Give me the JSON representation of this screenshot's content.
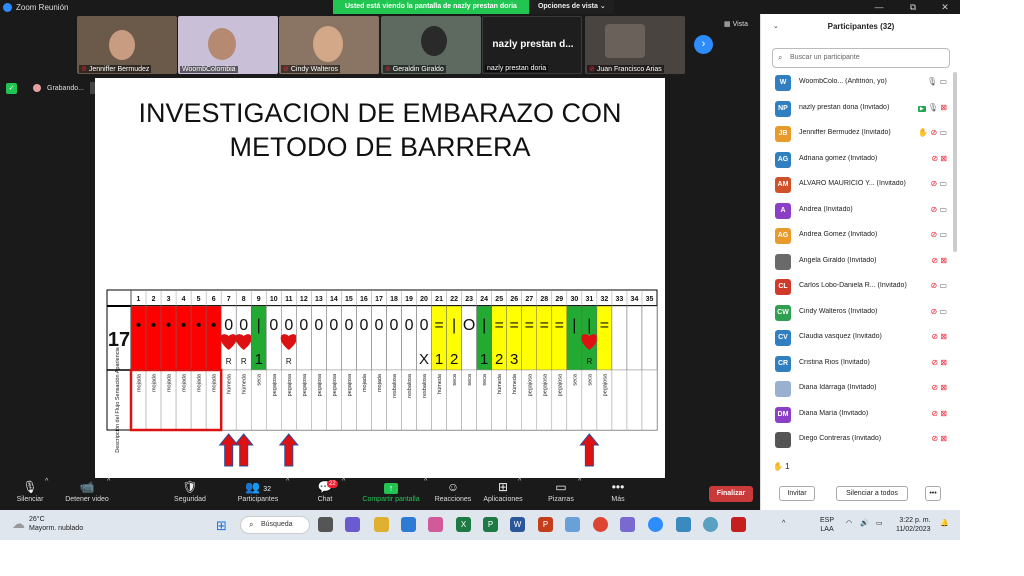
{
  "window": {
    "title": "Zoom Reunión",
    "banner": "Usted está viendo la pantalla de nazly prestan doria",
    "view_options": "Opciones de vista",
    "view_options_caret": "⌄",
    "win_min": "—",
    "win_max": "⧉",
    "win_close": "✕"
  },
  "gallery": {
    "tiles": [
      {
        "name": "Jenniffer Bermudez",
        "bg": "#6b5a4a",
        "muted": true
      },
      {
        "name": "WoombColombia",
        "bg": "#c9c0d8",
        "muted": false
      },
      {
        "name": "Cindy Walteros",
        "bg": "#8a7565",
        "muted": true
      },
      {
        "name": "Geraldin Giraldo",
        "bg": "#5e6a60",
        "muted": true
      },
      {
        "name": "nazly prestan doria",
        "bg": "#1e1e1e",
        "muted": false,
        "big_label": "nazly prestan d..."
      },
      {
        "name": "Juan Francisco Arias",
        "bg": "#4a4440",
        "muted": true
      }
    ],
    "next_icon": "›",
    "view_label": "Vista",
    "view_icon": "▦"
  },
  "recording": {
    "label": "Grabando...",
    "shield_glyph": "✓",
    "pause_glyph": "⏸",
    "stop_glyph": "■"
  },
  "slide": {
    "title_line1": "INVESTIGACION DE EMBARAZO CON",
    "title_line2": "METODO DE BARRERA",
    "row_label": "17",
    "side_label": "Descripción del Flujo Sensación Apariencia",
    "days": [
      "1",
      "2",
      "3",
      "4",
      "5",
      "6",
      "7",
      "8",
      "9",
      "10",
      "11",
      "12",
      "13",
      "14",
      "15",
      "16",
      "17",
      "18",
      "19",
      "20",
      "21",
      "22",
      "23",
      "24",
      "25",
      "26",
      "27",
      "28",
      "29",
      "30",
      "31",
      "32",
      "33",
      "34",
      "35"
    ],
    "cells": [
      {
        "bg": "#ff0000",
        "sym": "•",
        "lbl": "mojada"
      },
      {
        "bg": "#ff0000",
        "sym": "•",
        "lbl": "mojada"
      },
      {
        "bg": "#ff0000",
        "sym": "•",
        "lbl": "mojada"
      },
      {
        "bg": "#ff0000",
        "sym": "•",
        "lbl": "mojada"
      },
      {
        "bg": "#ff0000",
        "sym": "•",
        "lbl": "mojada"
      },
      {
        "bg": "#ff0000",
        "sym": "•",
        "lbl": "mojada"
      },
      {
        "bg": "#ffffff",
        "sym": "0",
        "heart": true,
        "sub": "R",
        "lbl": "húmeda"
      },
      {
        "bg": "#ffffff",
        "sym": "0",
        "heart": true,
        "sub": "R",
        "lbl": "húmeda"
      },
      {
        "bg": "#22aa33",
        "sym": "|",
        "sub": "1",
        "lbl": "seca"
      },
      {
        "bg": "#ffffff",
        "sym": "0",
        "lbl": "pegajosa"
      },
      {
        "bg": "#ffffff",
        "sym": "0",
        "heart": true,
        "sub": "R",
        "lbl": "pegajosa"
      },
      {
        "bg": "#ffffff",
        "sym": "0",
        "lbl": "pegajosa"
      },
      {
        "bg": "#ffffff",
        "sym": "0",
        "lbl": "pegajosa"
      },
      {
        "bg": "#ffffff",
        "sym": "0",
        "lbl": "pegajosa"
      },
      {
        "bg": "#ffffff",
        "sym": "0",
        "lbl": "pegajosa"
      },
      {
        "bg": "#ffffff",
        "sym": "0",
        "lbl": "mojada"
      },
      {
        "bg": "#ffffff",
        "sym": "0",
        "lbl": "mojada"
      },
      {
        "bg": "#ffffff",
        "sym": "0",
        "lbl": "resbalosa"
      },
      {
        "bg": "#ffffff",
        "sym": "0",
        "lbl": "resbalosa"
      },
      {
        "bg": "#ffffff",
        "sym": "0",
        "sub": "X",
        "lbl": "resbalosa"
      },
      {
        "bg": "#ffff00",
        "sym": "=",
        "sub": "1",
        "lbl": "húmeda"
      },
      {
        "bg": "#ffff00",
        "sym": "|",
        "sub": "2",
        "lbl": "seca"
      },
      {
        "bg": "#ffffff",
        "sym": "O",
        "lbl": "seca"
      },
      {
        "bg": "#22aa33",
        "sym": "|",
        "sub": "1",
        "lbl": "seca"
      },
      {
        "bg": "#ffff00",
        "sym": "=",
        "sub": "2",
        "lbl": "húmeda"
      },
      {
        "bg": "#ffff00",
        "sym": "=",
        "sub": "3",
        "lbl": "húmeda"
      },
      {
        "bg": "#ffff00",
        "sym": "=",
        "lbl": "pegajosa"
      },
      {
        "bg": "#ffff00",
        "sym": "=",
        "lbl": "pegajosa"
      },
      {
        "bg": "#ffff00",
        "sym": "=",
        "lbl": "pegajosa"
      },
      {
        "bg": "#22aa33",
        "sym": "|",
        "lbl": "seca"
      },
      {
        "bg": "#22aa33",
        "sym": "|",
        "heart": true,
        "sub": "R",
        "lbl": "seca"
      },
      {
        "bg": "#ffff00",
        "sym": "=",
        "lbl": "pegajosa"
      },
      {
        "bg": "#ffffff",
        "sym": "",
        "lbl": ""
      },
      {
        "bg": "#ffffff",
        "sym": "",
        "lbl": ""
      },
      {
        "bg": "#ffffff",
        "sym": "",
        "lbl": ""
      }
    ],
    "arrow_days": [
      7,
      8,
      11,
      31
    ],
    "colors": {
      "red": "#ff0000",
      "green": "#22aa33",
      "yellow": "#ffff00",
      "arrow": "#dd1111",
      "heart": "#dd1111"
    }
  },
  "toolbar": {
    "mute": {
      "label": "Silenciar",
      "icon": "🎙"
    },
    "video": {
      "label": "Detener video",
      "icon": "📹"
    },
    "security": {
      "label": "Seguridad",
      "icon": "🛡"
    },
    "participants": {
      "label": "Participantes",
      "count": "32",
      "icon": "👥"
    },
    "chat": {
      "label": "Chat",
      "badge": "22",
      "icon": "💬"
    },
    "share": {
      "label": "Compartir pantalla",
      "icon": "↑"
    },
    "reactions": {
      "label": "Reacciones",
      "icon": "☺"
    },
    "apps": {
      "label": "Aplicaciones",
      "icon": "⊞"
    },
    "whiteboards": {
      "label": "Pizarras",
      "icon": "▭"
    },
    "more": {
      "label": "Más",
      "icon": "•••"
    },
    "caret": "^",
    "end": "Finalizar"
  },
  "panel": {
    "collapse_icon": "⌄",
    "title": "Participantes (32)",
    "search_placeholder": "Buscar un participante",
    "search_icon": "⌕",
    "participants": [
      {
        "initials": "W",
        "color": "#2f7fc1",
        "name": "WoombColo...   (Anfitrión, yo)",
        "mic": "on",
        "cam": "on",
        "extra": ""
      },
      {
        "initials": "NP",
        "color": "#2f7fc1",
        "name": "nazly prestan doria  (Invitado)",
        "mic": "on",
        "cam": "off",
        "extra": "ppt"
      },
      {
        "initials": "JB",
        "color": "#e89a2a",
        "name": "Jenniffer Bermudez  (Invitado)",
        "mic": "off",
        "cam": "on",
        "extra": "hand"
      },
      {
        "initials": "AG",
        "color": "#2f7fc1",
        "name": "Adriana gomez  (Invitado)",
        "mic": "off",
        "cam": "off",
        "extra": ""
      },
      {
        "initials": "AM",
        "color": "#d0502a",
        "name": "ALVARO MAURICIO Y...   (Invitado)",
        "mic": "off",
        "cam": "on",
        "extra": ""
      },
      {
        "initials": "A",
        "color": "#8a3fc6",
        "name": "Andrea  (Invitado)",
        "mic": "off",
        "cam": "on",
        "extra": ""
      },
      {
        "initials": "AG",
        "color": "#e89a2a",
        "name": "Andrea Gomez  (Invitado)",
        "mic": "off",
        "cam": "on",
        "extra": ""
      },
      {
        "initials": "",
        "color": "#6a6a6a",
        "name": "Angela Giraldo  (Invitado)",
        "mic": "off",
        "cam": "off",
        "extra": ""
      },
      {
        "initials": "CL",
        "color": "#d03a2a",
        "name": "Carlos Lobo-Daniela R...  (Invitado)",
        "mic": "off",
        "cam": "on",
        "extra": ""
      },
      {
        "initials": "CW",
        "color": "#2fa050",
        "name": "Cindy Walteros  (Invitado)",
        "mic": "off",
        "cam": "on",
        "extra": ""
      },
      {
        "initials": "CV",
        "color": "#2f7fc1",
        "name": "Claudia vasquez  (Invitado)",
        "mic": "off",
        "cam": "off",
        "extra": ""
      },
      {
        "initials": "CR",
        "color": "#2f7fc1",
        "name": "Cristina Rios  (Invitado)",
        "mic": "off",
        "cam": "off",
        "extra": ""
      },
      {
        "initials": "",
        "color": "#9ab0d0",
        "name": "Diana Idárraga  (Invitado)",
        "mic": "off",
        "cam": "off",
        "extra": ""
      },
      {
        "initials": "DM",
        "color": "#8a3fc6",
        "name": "Diana María  (Invitado)",
        "mic": "off",
        "cam": "off",
        "extra": ""
      },
      {
        "initials": "",
        "color": "#555555",
        "name": "Diego Contreras  (Invitado)",
        "mic": "off",
        "cam": "off",
        "extra": ""
      }
    ],
    "raised_hands": "✋ 1",
    "invite": "Invitar",
    "mute_all": "Silenciar a todos",
    "more": "•••"
  },
  "taskbar": {
    "temp": "26°C",
    "weather": "Mayorm. nublado",
    "weather_icon": "☁",
    "start_icon": "⊞",
    "search": "Búsqueda",
    "search_icon": "⌕",
    "lang1": "ESP",
    "lang2": "LAA",
    "time": "3:22 p. m.",
    "date": "11/02/2023",
    "tray_up": "^",
    "wifi_icon": "◠",
    "vol_icon": "🔊",
    "batt_icon": "▭",
    "bell_icon": "🔔"
  }
}
